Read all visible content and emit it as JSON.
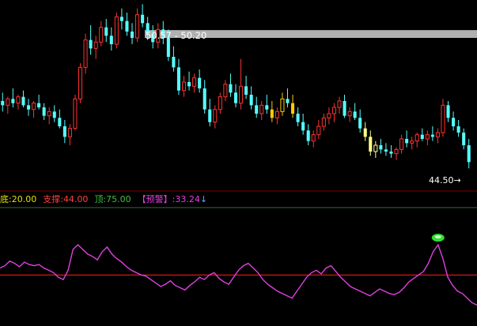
{
  "price_panel": {
    "range_label": "50.57 - 50.20",
    "last_price_label": "44.50",
    "arrow_glyph": "→"
  },
  "indicator_bar": {
    "di_label": "底:",
    "di_value": "20.00",
    "zhicheng_label": "支撑:",
    "zhicheng_value": "44.00",
    "ding_label": "顶:",
    "ding_value": "75.00",
    "yujing_label": "【预警】:",
    "yujing_value": "33.24",
    "down_arrow": "↓"
  },
  "colors": {
    "background": "#000000",
    "up_candle": "#ff3232",
    "down_candle": "#54ffff",
    "warn_candle": "#ffcc00",
    "green_candle": "#ffff88",
    "indicator_line": "#e040e0",
    "support_line": "#ff2020",
    "separator": "#800000",
    "band": "#b0b0b0",
    "di_color": "#e0e000",
    "zhicheng_color": "#ff4040",
    "ding_color": "#40c040",
    "yujing_color": "#e040e0",
    "marker": "#33dd33"
  },
  "chart_data": [
    {
      "type": "candlestick",
      "title": "",
      "ylim": [
        43.0,
        52.0
      ],
      "band": [
        50.2,
        50.57
      ],
      "last": 44.5,
      "candles": [
        [
          47.2,
          47.6,
          46.7,
          47.0
        ],
        [
          47.0,
          47.4,
          46.6,
          47.3
        ],
        [
          47.3,
          47.8,
          46.9,
          47.1
        ],
        [
          47.1,
          47.5,
          46.8,
          47.4
        ],
        [
          47.4,
          47.7,
          46.9,
          47.0
        ],
        [
          47.0,
          47.3,
          46.5,
          46.8
        ],
        [
          46.8,
          47.2,
          46.4,
          47.1
        ],
        [
          47.1,
          47.5,
          46.8,
          46.9
        ],
        [
          46.9,
          47.1,
          46.3,
          46.5
        ],
        [
          46.5,
          46.9,
          46.1,
          46.7
        ],
        [
          46.7,
          47.0,
          46.2,
          46.4
        ],
        [
          46.4,
          46.8,
          45.9,
          46.0
        ],
        [
          46.0,
          46.3,
          45.2,
          45.5
        ],
        [
          45.5,
          46.1,
          45.1,
          45.9
        ],
        [
          45.9,
          47.5,
          45.8,
          47.3
        ],
        [
          47.3,
          49.0,
          47.1,
          48.8
        ],
        [
          48.8,
          50.4,
          48.5,
          50.1
        ],
        [
          50.1,
          50.8,
          49.4,
          49.7
        ],
        [
          49.7,
          50.3,
          49.2,
          50.0
        ],
        [
          50.0,
          51.0,
          49.8,
          50.7
        ],
        [
          50.7,
          51.1,
          50.0,
          50.3
        ],
        [
          50.3,
          50.7,
          49.6,
          49.9
        ],
        [
          49.9,
          51.4,
          49.7,
          51.2
        ],
        [
          51.2,
          51.6,
          50.6,
          51.0
        ],
        [
          51.0,
          51.4,
          50.3,
          50.5
        ],
        [
          50.5,
          50.9,
          49.9,
          50.2
        ],
        [
          50.2,
          51.6,
          50.0,
          51.3
        ],
        [
          51.3,
          51.8,
          50.7,
          50.9
        ],
        [
          50.9,
          51.2,
          50.1,
          50.4
        ],
        [
          50.4,
          50.8,
          49.7,
          50.0
        ],
        [
          50.0,
          50.9,
          49.7,
          50.6
        ],
        [
          50.6,
          51.0,
          49.9,
          50.2
        ],
        [
          50.2,
          50.6,
          49.1,
          49.3
        ],
        [
          49.3,
          49.8,
          48.6,
          48.8
        ],
        [
          48.8,
          49.2,
          47.5,
          47.7
        ],
        [
          47.7,
          48.4,
          47.4,
          48.1
        ],
        [
          48.1,
          48.6,
          47.7,
          47.9
        ],
        [
          47.9,
          48.5,
          47.6,
          48.3
        ],
        [
          48.3,
          48.7,
          47.6,
          47.8
        ],
        [
          47.8,
          48.2,
          46.6,
          46.8
        ],
        [
          46.8,
          47.3,
          46.0,
          46.2
        ],
        [
          46.2,
          47.0,
          45.9,
          46.8
        ],
        [
          46.8,
          47.6,
          46.6,
          47.4
        ],
        [
          47.4,
          48.2,
          47.2,
          48.0
        ],
        [
          48.0,
          48.5,
          47.4,
          47.6
        ],
        [
          47.6,
          48.0,
          46.9,
          47.1
        ],
        [
          47.1,
          49.2,
          46.8,
          47.9
        ],
        [
          47.9,
          48.4,
          47.3,
          47.5
        ],
        [
          47.5,
          47.9,
          46.8,
          47.0
        ],
        [
          47.0,
          47.4,
          46.4,
          46.6
        ],
        [
          46.6,
          47.2,
          46.3,
          47.0
        ],
        [
          47.0,
          47.5,
          46.6,
          46.8
        ],
        [
          46.8,
          47.2,
          46.2,
          46.4
        ],
        [
          46.4,
          46.9,
          46.1,
          46.7
        ],
        [
          46.7,
          47.6,
          46.5,
          47.3
        ],
        [
          47.3,
          47.8,
          46.9,
          47.1
        ],
        [
          47.1,
          47.5,
          46.4,
          46.6
        ],
        [
          46.6,
          46.9,
          46.0,
          46.2
        ],
        [
          46.2,
          46.6,
          45.6,
          45.8
        ],
        [
          45.8,
          46.1,
          45.1,
          45.3
        ],
        [
          45.3,
          45.8,
          45.0,
          45.6
        ],
        [
          45.6,
          46.3,
          45.4,
          46.0
        ],
        [
          46.0,
          46.6,
          45.8,
          46.4
        ],
        [
          46.4,
          46.9,
          46.1,
          46.6
        ],
        [
          46.6,
          47.1,
          46.2,
          46.9
        ],
        [
          46.9,
          47.4,
          46.6,
          47.2
        ],
        [
          47.2,
          47.5,
          46.4,
          46.5
        ],
        [
          46.5,
          46.9,
          46.2,
          46.7
        ],
        [
          46.7,
          47.1,
          46.3,
          46.4
        ],
        [
          46.4,
          46.8,
          45.7,
          45.9
        ],
        [
          45.9,
          46.2,
          45.3,
          45.5
        ],
        [
          45.5,
          45.8,
          44.6,
          44.8
        ],
        [
          44.8,
          45.3,
          44.5,
          45.1
        ],
        [
          45.1,
          45.4,
          44.7,
          44.9
        ],
        [
          44.9,
          45.2,
          44.6,
          44.8
        ],
        [
          44.8,
          45.1,
          44.5,
          44.7
        ],
        [
          44.7,
          45.0,
          44.4,
          44.9
        ],
        [
          44.9,
          45.6,
          44.7,
          45.4
        ],
        [
          45.4,
          45.8,
          45.0,
          45.2
        ],
        [
          45.2,
          45.5,
          44.9,
          45.3
        ],
        [
          45.3,
          45.7,
          45.0,
          45.6
        ],
        [
          45.6,
          45.9,
          45.3,
          45.4
        ],
        [
          45.4,
          45.8,
          45.1,
          45.6
        ],
        [
          45.6,
          46.0,
          45.3,
          45.5
        ],
        [
          45.5,
          45.9,
          45.2,
          45.7
        ],
        [
          45.7,
          47.3,
          45.5,
          47.0
        ],
        [
          47.0,
          47.2,
          46.2,
          46.4
        ],
        [
          46.4,
          46.7,
          45.8,
          46.0
        ],
        [
          46.0,
          46.3,
          45.5,
          45.7
        ],
        [
          45.7,
          45.9,
          44.9,
          45.1
        ],
        [
          45.1,
          45.4,
          44.0,
          44.3
        ]
      ],
      "candle_colors_note": "Candles are red when close >= open, cyan when close < open"
    },
    {
      "type": "line",
      "title": "",
      "ylim": [
        0,
        100
      ],
      "support": 44.0,
      "bottom": 20.0,
      "top": 75.0,
      "series": [
        {
          "values": [
            50,
            52,
            56,
            54,
            51,
            55,
            53,
            52,
            53,
            50,
            48,
            46,
            42,
            40,
            48,
            66,
            70,
            66,
            62,
            60,
            57,
            64,
            68,
            62,
            58,
            55,
            51,
            48,
            46,
            44,
            43,
            40,
            37,
            34,
            36,
            39,
            35,
            33,
            31,
            35,
            38,
            42,
            40,
            44,
            46,
            41,
            38,
            36,
            42,
            48,
            52,
            54,
            50,
            46,
            40,
            36,
            33,
            30,
            28,
            26,
            24,
            30,
            36,
            42,
            46,
            48,
            45,
            50,
            52,
            47,
            42,
            38,
            34,
            32,
            30,
            28,
            26,
            29,
            32,
            30,
            28,
            27,
            29,
            33,
            38,
            41,
            44,
            47,
            54,
            64,
            70,
            58,
            42,
            35,
            30,
            28,
            24,
            20,
            18
          ]
        }
      ]
    }
  ]
}
